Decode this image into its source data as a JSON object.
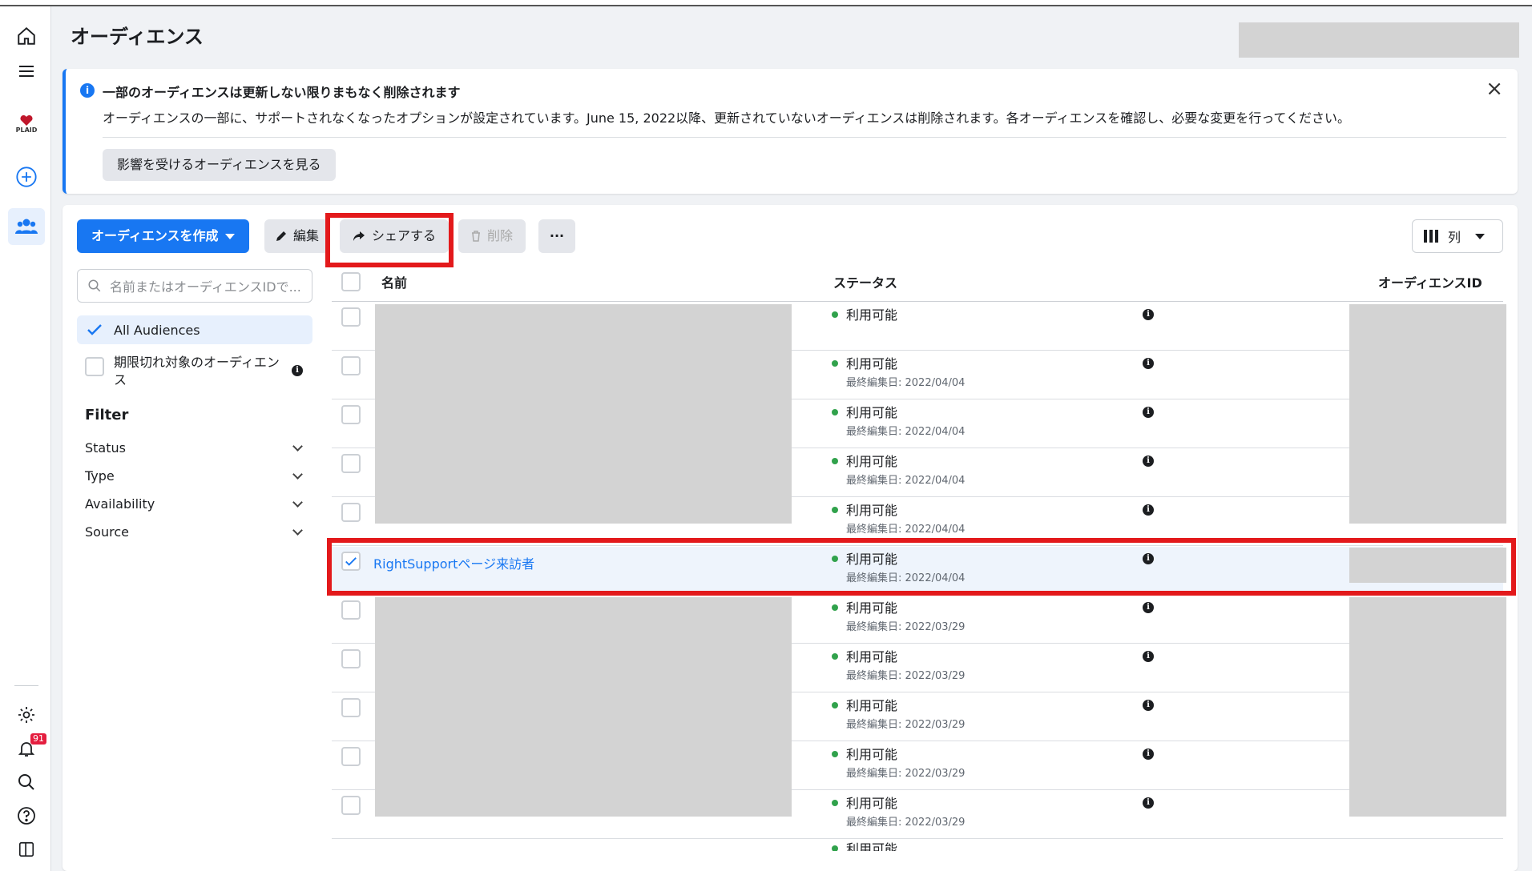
{
  "page": {
    "title": "オーディエンス"
  },
  "rail": {
    "notification_count": "91",
    "brand_text": "PLAID"
  },
  "notice": {
    "title": "一部のオーディエンスは更新しない限りまもなく削除されます",
    "body": "オーディエンスの一部に、サポートされなくなったオプションが設定されています。June 15, 2022以降、更新されていないオーディエンスは削除されます。各オーディエンスを確認し、必要な変更を行ってください。",
    "button": "影響を受けるオーディエンスを見る"
  },
  "toolbar": {
    "create": "オーディエンスを作成",
    "edit": "編集",
    "share": "シェアする",
    "delete": "削除",
    "more": "···",
    "columns": "列"
  },
  "sidebar": {
    "search_placeholder": "名前またはオーディエンスIDで...",
    "all_audiences": "All Audiences",
    "expiring": "期限切れ対象のオーディエンス",
    "filter_title": "Filter",
    "filters": [
      "Status",
      "Type",
      "Availability",
      "Source"
    ]
  },
  "table": {
    "headers": {
      "name": "名前",
      "status": "ステータス",
      "audience_id": "オーディエンスID"
    },
    "rows": [
      {
        "name": "",
        "status": "利用可能",
        "date": ""
      },
      {
        "name": "",
        "status": "利用可能",
        "date": "最終編集日: 2022/04/04"
      },
      {
        "name": "",
        "status": "利用可能",
        "date": "最終編集日: 2022/04/04"
      },
      {
        "name": "",
        "status": "利用可能",
        "date": "最終編集日: 2022/04/04"
      },
      {
        "name": "",
        "status": "利用可能",
        "date": "最終編集日: 2022/04/04"
      },
      {
        "name": "RightSupportページ来訪者",
        "status": "利用可能",
        "date": "最終編集日: 2022/04/04"
      },
      {
        "name": "",
        "status": "利用可能",
        "date": "最終編集日: 2022/03/29"
      },
      {
        "name": "",
        "status": "利用可能",
        "date": "最終編集日: 2022/03/29"
      },
      {
        "name": "",
        "status": "利用可能",
        "date": "最終編集日: 2022/03/29"
      },
      {
        "name": "",
        "status": "利用可能",
        "date": "最終編集日: 2022/03/29"
      },
      {
        "name": "",
        "status": "利用可能",
        "date": "最終編集日: 2022/03/29"
      },
      {
        "name": "",
        "status": "利用可能",
        "date": ""
      }
    ]
  },
  "colors": {
    "accent": "#1877f2",
    "highlight": "#e3191b",
    "status_green": "#31a24c"
  }
}
